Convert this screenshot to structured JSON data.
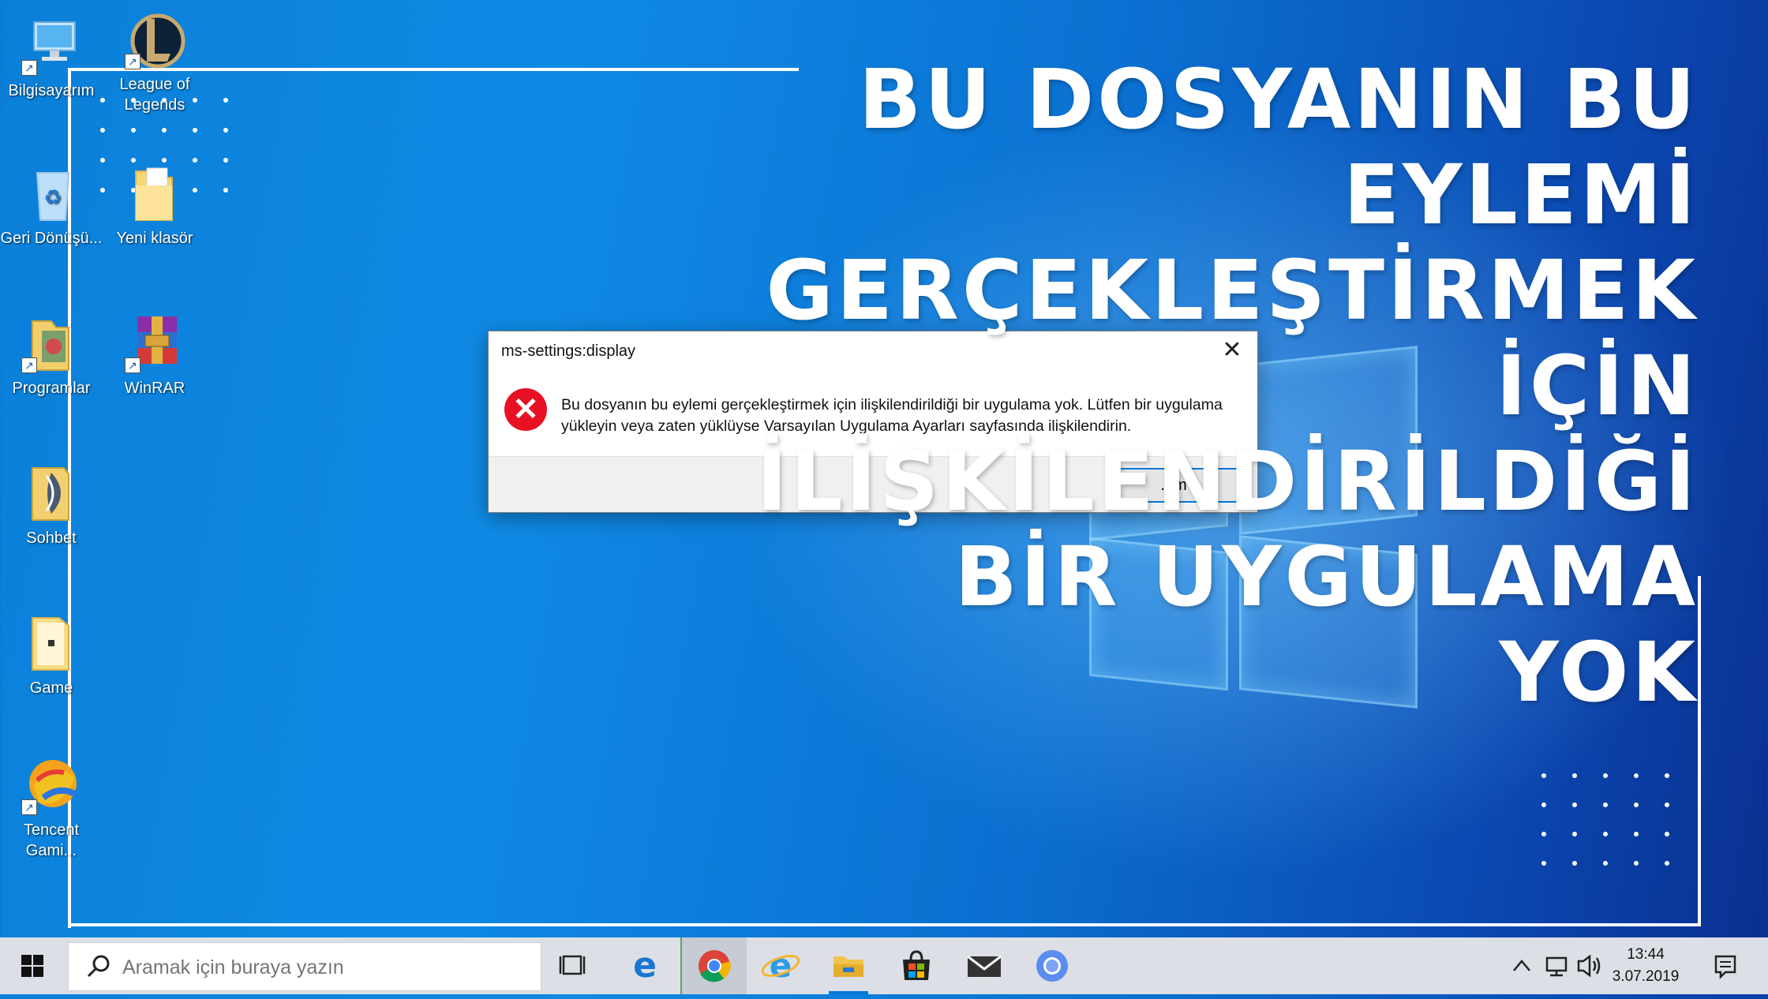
{
  "desktop": {
    "icons": [
      {
        "label": "Bilgisayarım",
        "icon": "computer-icon"
      },
      {
        "label": "League of Legends",
        "icon": "league-of-legends-icon"
      },
      {
        "label": "Geri Dönüşü...",
        "icon": "recycle-bin-icon"
      },
      {
        "label": "Yeni klasör",
        "icon": "folder-icon"
      },
      {
        "label": "Programlar",
        "icon": "programs-icon"
      },
      {
        "label": "WinRAR",
        "icon": "winrar-icon"
      },
      {
        "label": "Sohbet",
        "icon": "chat-icon"
      },
      {
        "label": "Game",
        "icon": "folder-icon"
      },
      {
        "label": "Tencent Gami...",
        "icon": "tencent-gaming-icon"
      }
    ]
  },
  "headline": {
    "lines": [
      "BU DOSYANIN BU",
      "EYLEMİ",
      "GERÇEKLEŞTİRMEK",
      "İÇİN",
      "İLİŞKİLENDİRİLDİĞİ",
      "BİR UYGULAMA",
      "YOK"
    ]
  },
  "dialog": {
    "title": "ms-settings:display",
    "message": "Bu dosyanın bu eylemi gerçekleştirmek için ilişkilendirildiği bir uygulama yok. Lütfen bir uygulama yükleyin veya zaten yüklüyse Varsayılan Uygulama Ayarları sayfasında ilişkilendirin.",
    "button": "...m",
    "error_color": "#e81123"
  },
  "taskbar": {
    "search_placeholder": "Aramak için buraya yazın",
    "apps": [
      "task-view-icon",
      "edge-icon",
      "chrome-icon",
      "internet-explorer-icon",
      "file-explorer-icon",
      "store-icon",
      "mail-icon",
      "chromium-icon"
    ],
    "time": "13:44",
    "date": "3.07.2019",
    "accent": "#0078d7"
  }
}
